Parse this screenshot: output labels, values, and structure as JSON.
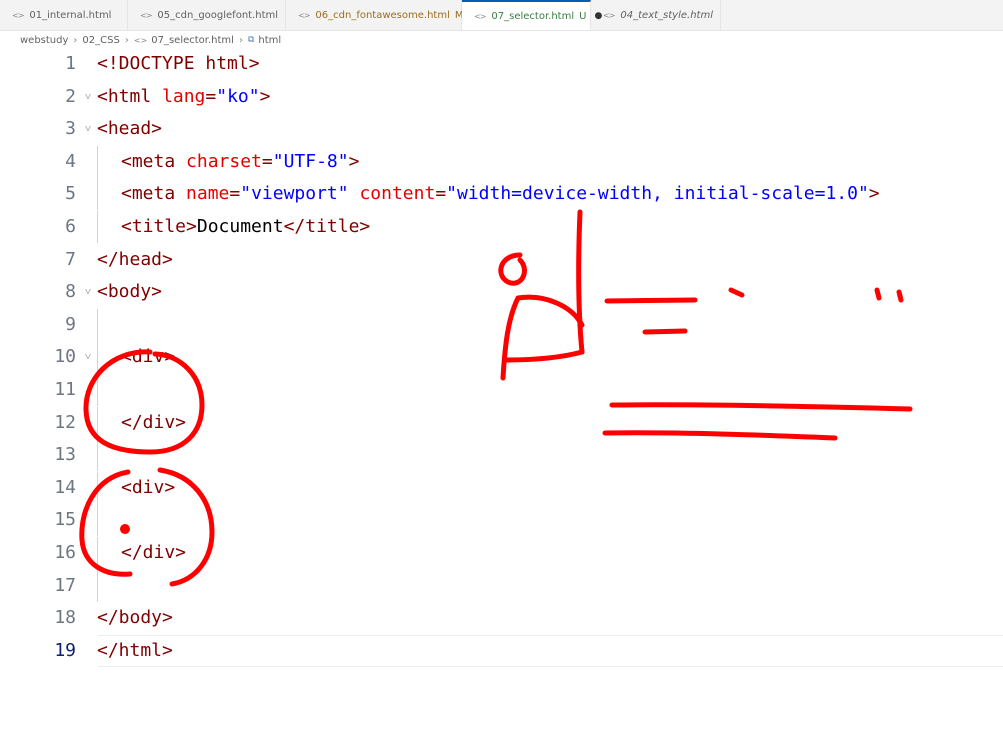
{
  "tabs": [
    {
      "label": "01_internal.html",
      "status": "",
      "state": "normal"
    },
    {
      "label": "05_cdn_googlefont.html",
      "status": "",
      "state": "normal"
    },
    {
      "label": "06_cdn_fontawesome.html",
      "status": "M",
      "state": "modified"
    },
    {
      "label": "07_selector.html",
      "status": "U",
      "state": "active"
    },
    {
      "label": "04_text_style.html",
      "status": "",
      "state": "preview"
    }
  ],
  "breadcrumb": [
    "webstudy",
    "02_CSS",
    "07_selector.html",
    "html"
  ],
  "editor": {
    "current_line": 19,
    "lines": [
      {
        "n": 1,
        "fold": false,
        "tokens": [
          [
            "tag",
            "<!DOCTYPE html>"
          ]
        ]
      },
      {
        "n": 2,
        "fold": true,
        "tokens": [
          [
            "tag",
            "<html "
          ],
          [
            "attr",
            "lang"
          ],
          [
            "tag",
            "="
          ],
          [
            "str",
            "\"ko\""
          ],
          [
            "tag",
            ">"
          ]
        ]
      },
      {
        "n": 3,
        "fold": true,
        "tokens": [
          [
            "tag",
            "<head>"
          ]
        ]
      },
      {
        "n": 4,
        "fold": false,
        "indent": 1,
        "tokens": [
          [
            "tag",
            "<meta "
          ],
          [
            "attr",
            "charset"
          ],
          [
            "tag",
            "="
          ],
          [
            "str",
            "\"UTF-8\""
          ],
          [
            "tag",
            ">"
          ]
        ]
      },
      {
        "n": 5,
        "fold": false,
        "indent": 1,
        "tokens": [
          [
            "tag",
            "<meta "
          ],
          [
            "attr",
            "name"
          ],
          [
            "tag",
            "="
          ],
          [
            "str",
            "\"viewport\""
          ],
          [
            "tag",
            " "
          ],
          [
            "attr",
            "content"
          ],
          [
            "tag",
            "="
          ],
          [
            "str",
            "\"width=device-width, initial-scale=1.0\""
          ],
          [
            "tag",
            ">"
          ]
        ]
      },
      {
        "n": 6,
        "fold": false,
        "indent": 1,
        "tokens": [
          [
            "tag",
            "<title>"
          ],
          [
            "text",
            "Document"
          ],
          [
            "tag",
            "</title>"
          ]
        ]
      },
      {
        "n": 7,
        "fold": false,
        "tokens": [
          [
            "tag",
            "</head>"
          ]
        ]
      },
      {
        "n": 8,
        "fold": true,
        "tokens": [
          [
            "tag",
            "<body>"
          ]
        ]
      },
      {
        "n": 9,
        "fold": false,
        "guides": 1,
        "tokens": []
      },
      {
        "n": 10,
        "fold": true,
        "indent": 1,
        "tokens": [
          [
            "tag",
            "<div>"
          ]
        ]
      },
      {
        "n": 11,
        "fold": false,
        "guides": 1,
        "tokens": []
      },
      {
        "n": 12,
        "fold": false,
        "indent": 1,
        "tokens": [
          [
            "tag",
            "</div>"
          ]
        ]
      },
      {
        "n": 13,
        "fold": false,
        "guides": 1,
        "tokens": []
      },
      {
        "n": 14,
        "fold": false,
        "indent": 1,
        "tokens": [
          [
            "tag",
            "<div>"
          ]
        ]
      },
      {
        "n": 15,
        "fold": false,
        "guides": 1,
        "tokens": []
      },
      {
        "n": 16,
        "fold": false,
        "indent": 1,
        "tokens": [
          [
            "tag",
            "</div>"
          ]
        ]
      },
      {
        "n": 17,
        "fold": false,
        "guides": 1,
        "tokens": []
      },
      {
        "n": 18,
        "fold": false,
        "tokens": [
          [
            "tag",
            "</body>"
          ]
        ]
      },
      {
        "n": 19,
        "fold": false,
        "tokens": [
          [
            "tag",
            "</html>"
          ]
        ]
      }
    ]
  },
  "colors": {
    "tag": "#800000",
    "attribute": "#e50000",
    "string": "#0000ff",
    "text": "#000000",
    "line_number": "#6e7681",
    "line_number_active": "#0b216f",
    "active_tab_accent": "#005fb8",
    "ink_annotation": "#ff0000"
  },
  "icons": {
    "tab": "html-file-icon",
    "breadcrumb_file": "html-file-icon",
    "breadcrumb_symbol": "element-symbol-icon",
    "dirty": "unsaved-dot-icon",
    "fold": "chevron-down-icon"
  }
}
